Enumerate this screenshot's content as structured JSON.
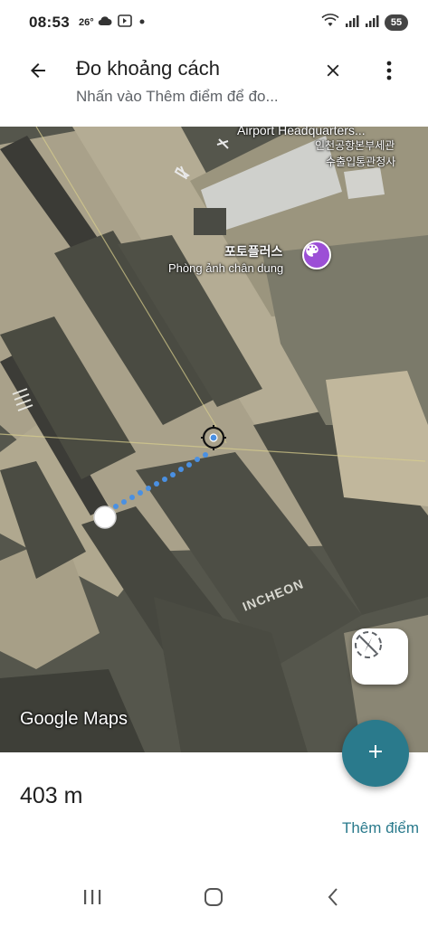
{
  "status_bar": {
    "time": "08:53",
    "temperature": "26°",
    "battery": "55",
    "left_icons": [
      "weather-cloud-icon",
      "cast-icon",
      "notification-dot-icon"
    ],
    "right_icons": [
      "wifi-icon",
      "signal-1-icon",
      "signal-2-icon",
      "battery-icon"
    ]
  },
  "header": {
    "title": "Đo khoảng cách",
    "subtitle": "Nhấn vào Thêm điểm để đo...",
    "back_icon": "arrow-back-icon",
    "close_icon": "close-icon",
    "more_icon": "more-vert-icon"
  },
  "map": {
    "labels": {
      "hq_en": "Airport Headquarters...",
      "hq_ko_1": "인천공항본부세관",
      "hq_ko_2": "수출입통관청사",
      "poi_ko": "포토플러스",
      "poi_vi": "Phòng ảnh chân dung",
      "ground_text": "INCHEON"
    },
    "google_logo": "Google Maps",
    "poi_icon": "palette-icon",
    "compass_icon": "compass-icon"
  },
  "measurement": {
    "distance": "403 m",
    "add_point_label": "Thêm điểm",
    "fab_icon": "plus-icon"
  },
  "nav_bar": {
    "icons": [
      "recent-apps-icon",
      "home-icon",
      "back-nav-icon"
    ]
  },
  "colors": {
    "accent": "#2a7a8c",
    "poi": "#9c4fd6",
    "measure_line": "#4a90e2"
  }
}
